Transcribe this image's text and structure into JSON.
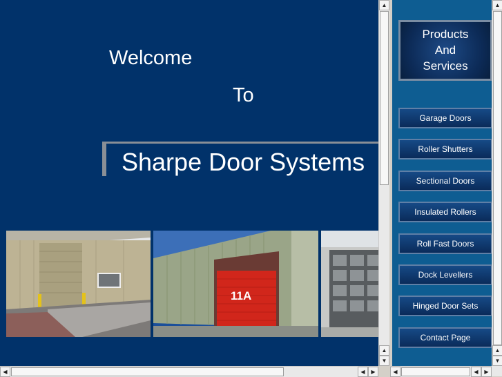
{
  "main": {
    "welcome": "Welcome",
    "to": "To",
    "company": "Sharpe Door Systems",
    "door_label": "11A"
  },
  "side": {
    "header_lines": [
      "Products",
      "And",
      "Services"
    ],
    "nav": [
      {
        "label": "Garage Doors"
      },
      {
        "label": "Roller Shutters"
      },
      {
        "label": "Sectional Doors"
      },
      {
        "label": "Insulated Rollers"
      },
      {
        "label": "Roll Fast Doors"
      },
      {
        "label": "Dock Levellers"
      },
      {
        "label": "Hinged Door Sets"
      },
      {
        "label": "Contact Page"
      }
    ]
  },
  "colors": {
    "main_bg": "#01326a",
    "side_bg": "#0e5d92",
    "door_red": "#d1261b"
  }
}
